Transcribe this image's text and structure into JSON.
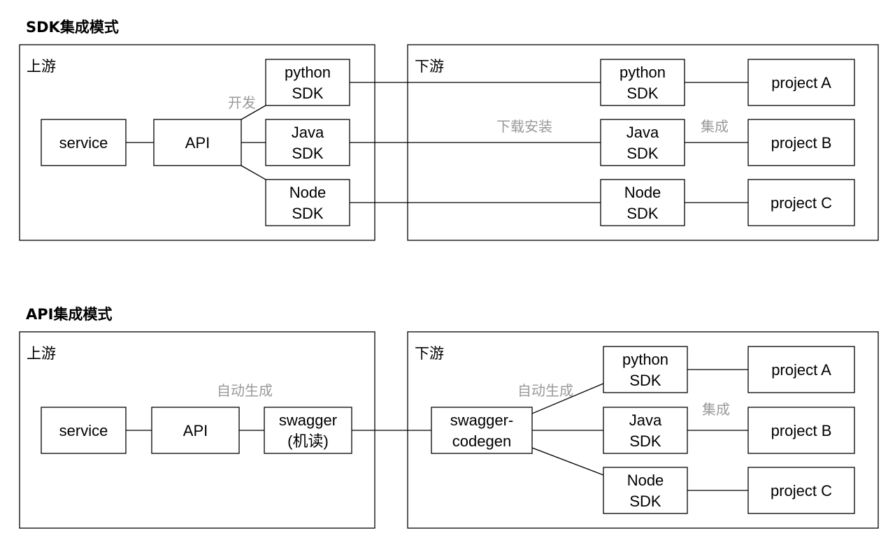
{
  "colors": {
    "line": "#000000",
    "annotation": "#999999",
    "background": "#ffffff"
  },
  "sections": [
    {
      "id": "sdk",
      "title": "SDK集成模式",
      "upstream_label": "上游",
      "downstream_label": "下游",
      "nodes": [
        {
          "id": "service",
          "label": [
            "service"
          ]
        },
        {
          "id": "api",
          "label": [
            "API"
          ]
        },
        {
          "id": "up-python",
          "label": [
            "python",
            "SDK"
          ]
        },
        {
          "id": "up-java",
          "label": [
            "Java",
            "SDK"
          ]
        },
        {
          "id": "up-node",
          "label": [
            "Node",
            "SDK"
          ]
        },
        {
          "id": "down-python",
          "label": [
            "python",
            "SDK"
          ]
        },
        {
          "id": "down-java",
          "label": [
            "Java",
            "SDK"
          ]
        },
        {
          "id": "down-node",
          "label": [
            "Node",
            "SDK"
          ]
        },
        {
          "id": "project-a",
          "label": [
            "project A"
          ]
        },
        {
          "id": "project-b",
          "label": [
            "project B"
          ]
        },
        {
          "id": "project-c",
          "label": [
            "project C"
          ]
        }
      ],
      "edges": [
        [
          "service",
          "api"
        ],
        [
          "api",
          "up-python"
        ],
        [
          "api",
          "up-java"
        ],
        [
          "api",
          "up-node"
        ],
        [
          "up-python",
          "down-python"
        ],
        [
          "up-java",
          "down-java"
        ],
        [
          "up-node",
          "down-node"
        ],
        [
          "down-python",
          "project-a"
        ],
        [
          "down-java",
          "project-b"
        ],
        [
          "down-node",
          "project-c"
        ]
      ],
      "annotations": [
        {
          "id": "develop",
          "text": "开发"
        },
        {
          "id": "download-install",
          "text": "下载安装"
        },
        {
          "id": "integrate",
          "text": "集成"
        }
      ]
    },
    {
      "id": "api",
      "title": "API集成模式",
      "upstream_label": "上游",
      "downstream_label": "下游",
      "nodes": [
        {
          "id": "service",
          "label": [
            "service"
          ]
        },
        {
          "id": "api",
          "label": [
            "API"
          ]
        },
        {
          "id": "swagger",
          "label": [
            "swagger",
            "(机读)"
          ]
        },
        {
          "id": "codegen",
          "label": [
            "swagger-",
            "codegen"
          ]
        },
        {
          "id": "down-python",
          "label": [
            "python",
            "SDK"
          ]
        },
        {
          "id": "down-java",
          "label": [
            "Java",
            "SDK"
          ]
        },
        {
          "id": "down-node",
          "label": [
            "Node",
            "SDK"
          ]
        },
        {
          "id": "project-a",
          "label": [
            "project A"
          ]
        },
        {
          "id": "project-b",
          "label": [
            "project B"
          ]
        },
        {
          "id": "project-c",
          "label": [
            "project C"
          ]
        }
      ],
      "edges": [
        [
          "service",
          "api"
        ],
        [
          "api",
          "swagger"
        ],
        [
          "swagger",
          "codegen"
        ],
        [
          "codegen",
          "down-python"
        ],
        [
          "codegen",
          "down-java"
        ],
        [
          "codegen",
          "down-node"
        ],
        [
          "down-python",
          "project-a"
        ],
        [
          "down-java",
          "project-b"
        ],
        [
          "down-node",
          "project-c"
        ]
      ],
      "annotations": [
        {
          "id": "auto-generate-up",
          "text": "自动生成"
        },
        {
          "id": "auto-generate-down",
          "text": "自动生成"
        },
        {
          "id": "integrate",
          "text": "集成"
        }
      ]
    }
  ]
}
